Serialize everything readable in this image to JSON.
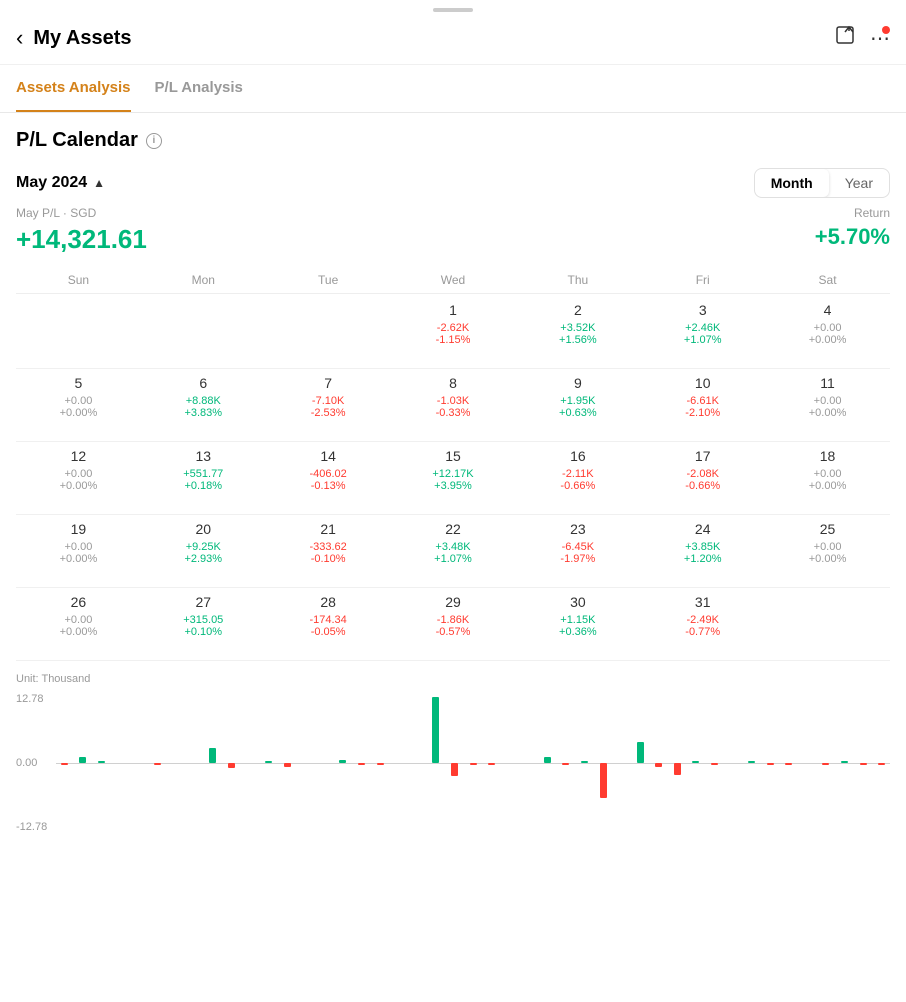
{
  "app": {
    "drag_indicator": true,
    "header": {
      "back_label": "‹",
      "title": "My Assets",
      "export_icon": "export",
      "more_icon": "more",
      "notification_dot": true
    },
    "tabs": [
      {
        "id": "assets",
        "label": "Assets Analysis",
        "active": true
      },
      {
        "id": "pl",
        "label": "P/L Analysis",
        "active": false
      }
    ]
  },
  "calendar": {
    "title": "P/L Calendar",
    "month_selector": "May 2024",
    "view_month": "Month",
    "view_year": "Year",
    "active_view": "Month",
    "summary": {
      "label": "May P/L · SGD",
      "value": "+14,321.61",
      "return_label": "Return",
      "return_value": "+5.70%"
    },
    "day_headers": [
      "Sun",
      "Mon",
      "Tue",
      "Wed",
      "Thu",
      "Fri",
      "Sat"
    ],
    "weeks": [
      [
        {
          "date": "",
          "pnl": "",
          "pct": ""
        },
        {
          "date": "",
          "pnl": "",
          "pct": ""
        },
        {
          "date": "",
          "pnl": "",
          "pct": ""
        },
        {
          "date": "1",
          "pnl": "-2.62K",
          "pct": "-1.15%",
          "color": "red"
        },
        {
          "date": "2",
          "pnl": "+3.52K",
          "pct": "+1.56%",
          "color": "green"
        },
        {
          "date": "3",
          "pnl": "+2.46K",
          "pct": "+1.07%",
          "color": "green"
        },
        {
          "date": "4",
          "pnl": "+0.00",
          "pct": "+0.00%",
          "color": "gray"
        }
      ],
      [
        {
          "date": "5",
          "pnl": "+0.00",
          "pct": "+0.00%",
          "color": "gray"
        },
        {
          "date": "6",
          "pnl": "+8.88K",
          "pct": "+3.83%",
          "color": "green"
        },
        {
          "date": "7",
          "pnl": "-7.10K",
          "pct": "-2.53%",
          "color": "red"
        },
        {
          "date": "8",
          "pnl": "-1.03K",
          "pct": "-0.33%",
          "color": "red"
        },
        {
          "date": "9",
          "pnl": "+1.95K",
          "pct": "+0.63%",
          "color": "green"
        },
        {
          "date": "10",
          "pnl": "-6.61K",
          "pct": "-2.10%",
          "color": "red"
        },
        {
          "date": "11",
          "pnl": "+0.00",
          "pct": "+0.00%",
          "color": "gray"
        }
      ],
      [
        {
          "date": "12",
          "pnl": "+0.00",
          "pct": "+0.00%",
          "color": "gray"
        },
        {
          "date": "13",
          "pnl": "+551.77",
          "pct": "+0.18%",
          "color": "green"
        },
        {
          "date": "14",
          "pnl": "-406.02",
          "pct": "-0.13%",
          "color": "red"
        },
        {
          "date": "15",
          "pnl": "+12.17K",
          "pct": "+3.95%",
          "color": "green"
        },
        {
          "date": "16",
          "pnl": "-2.11K",
          "pct": "-0.66%",
          "color": "red"
        },
        {
          "date": "17",
          "pnl": "-2.08K",
          "pct": "-0.66%",
          "color": "red"
        },
        {
          "date": "18",
          "pnl": "+0.00",
          "pct": "+0.00%",
          "color": "gray"
        }
      ],
      [
        {
          "date": "19",
          "pnl": "+0.00",
          "pct": "+0.00%",
          "color": "gray"
        },
        {
          "date": "20",
          "pnl": "+9.25K",
          "pct": "+2.93%",
          "color": "green"
        },
        {
          "date": "21",
          "pnl": "-333.62",
          "pct": "-0.10%",
          "color": "red"
        },
        {
          "date": "22",
          "pnl": "+3.48K",
          "pct": "+1.07%",
          "color": "green"
        },
        {
          "date": "23",
          "pnl": "-6.45K",
          "pct": "-1.97%",
          "color": "red"
        },
        {
          "date": "24",
          "pnl": "+3.85K",
          "pct": "+1.20%",
          "color": "green"
        },
        {
          "date": "25",
          "pnl": "+0.00",
          "pct": "+0.00%",
          "color": "gray"
        }
      ],
      [
        {
          "date": "26",
          "pnl": "+0.00",
          "pct": "+0.00%",
          "color": "gray"
        },
        {
          "date": "27",
          "pnl": "+315.05",
          "pct": "+0.10%",
          "color": "green"
        },
        {
          "date": "28",
          "pnl": "-174.34",
          "pct": "-0.05%",
          "color": "red"
        },
        {
          "date": "29",
          "pnl": "-1.86K",
          "pct": "-0.57%",
          "color": "red"
        },
        {
          "date": "30",
          "pnl": "+1.15K",
          "pct": "+0.36%",
          "color": "green"
        },
        {
          "date": "31",
          "pnl": "-2.49K",
          "pct": "-0.77%",
          "color": "red"
        },
        {
          "date": "",
          "pnl": "",
          "pct": ""
        }
      ]
    ]
  },
  "chart": {
    "unit_label": "Unit: Thousand",
    "y_top": "12.78",
    "y_mid": "0.00",
    "y_bot": "-12.78",
    "bars": [
      {
        "pos": 0,
        "neg": 2
      },
      {
        "pos": 9,
        "neg": 0
      },
      {
        "pos": 3,
        "neg": 0
      },
      {
        "pos": 0,
        "neg": 0
      },
      {
        "pos": 0,
        "neg": 0
      },
      {
        "pos": 0,
        "neg": 3
      },
      {
        "pos": 0,
        "neg": 0
      },
      {
        "pos": 0,
        "neg": 0
      },
      {
        "pos": 21,
        "neg": 0
      },
      {
        "pos": 0,
        "neg": 7
      },
      {
        "pos": 0,
        "neg": 0
      },
      {
        "pos": 2,
        "neg": 0
      },
      {
        "pos": 0,
        "neg": 5
      },
      {
        "pos": 0,
        "neg": 0
      },
      {
        "pos": 0,
        "neg": 0
      },
      {
        "pos": 4,
        "neg": 0
      },
      {
        "pos": 0,
        "neg": 3
      },
      {
        "pos": 0,
        "neg": 3
      },
      {
        "pos": 0,
        "neg": 0
      },
      {
        "pos": 0,
        "neg": 0
      },
      {
        "pos": 95,
        "neg": 0
      },
      {
        "pos": 0,
        "neg": 18
      },
      {
        "pos": 0,
        "neg": 2
      },
      {
        "pos": 0,
        "neg": 2
      },
      {
        "pos": 0,
        "neg": 0
      },
      {
        "pos": 0,
        "neg": 0
      },
      {
        "pos": 9,
        "neg": 0
      },
      {
        "pos": 0,
        "neg": 2
      },
      {
        "pos": 3,
        "neg": 0
      },
      {
        "pos": 0,
        "neg": 50
      },
      {
        "pos": 0,
        "neg": 0
      },
      {
        "pos": 30,
        "neg": 0
      },
      {
        "pos": 0,
        "neg": 5
      },
      {
        "pos": 0,
        "neg": 17
      },
      {
        "pos": 3,
        "neg": 0
      },
      {
        "pos": 0,
        "neg": 3
      },
      {
        "pos": 0,
        "neg": 0
      },
      {
        "pos": 2,
        "neg": 0
      },
      {
        "pos": 0,
        "neg": 3
      },
      {
        "pos": 0,
        "neg": 3
      },
      {
        "pos": 0,
        "neg": 0
      },
      {
        "pos": 0,
        "neg": 3
      },
      {
        "pos": 2,
        "neg": 0
      },
      {
        "pos": 0,
        "neg": 2
      },
      {
        "pos": 0,
        "neg": 2
      }
    ]
  }
}
